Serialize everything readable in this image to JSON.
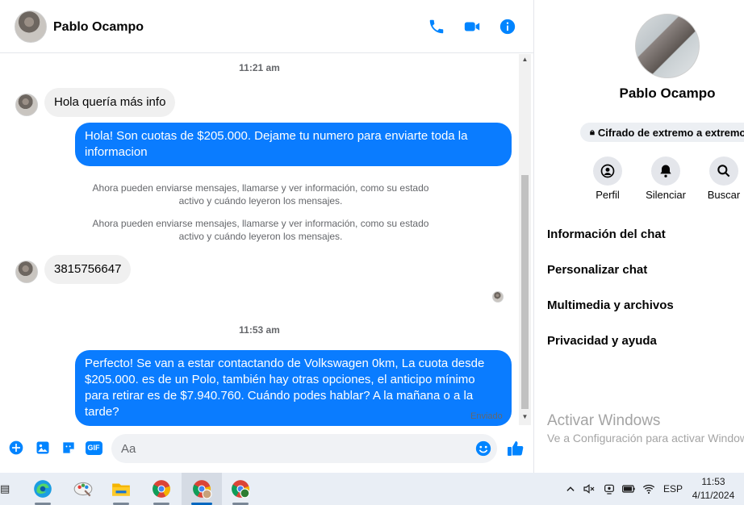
{
  "chat": {
    "contact_name": "Pablo Ocampo",
    "timestamp_1": "11:21 am",
    "msg_in_1": "Hola quería más info",
    "msg_out_1": "Hola! Son cuotas de $205.000. Dejame tu numero para enviarte toda la informacion",
    "system_note_1": "Ahora pueden enviarse mensajes, llamarse y ver información, como su estado activo y cuándo leyeron los mensajes.",
    "system_note_2": "Ahora pueden enviarse mensajes, llamarse y ver información, como su estado activo y cuándo leyeron los mensajes.",
    "msg_in_2": "3815756647",
    "timestamp_2": "11:53 am",
    "msg_out_2": "Perfecto!  Se van a estar contactando de Volkswagen 0km, La cuota desde $205.000. es de un Polo, también hay otras opciones, el anticipo mínimo para retirar es de $7.940.760. Cuándo podes hablar? A la mañana o a la tarde?",
    "status": "Enviado"
  },
  "header_icons": [
    "phone-icon",
    "video-camera-icon",
    "info-icon"
  ],
  "composer": {
    "placeholder": "Aa",
    "icons": [
      "plus-icon",
      "photo-icon",
      "sticker-icon",
      "gif-icon",
      "emoji-icon",
      "thumbs-up-icon"
    ],
    "gif_label": "GIF"
  },
  "info": {
    "name": "Pablo Ocampo",
    "encryption_badge": "Cifrado de extremo a extremo",
    "actions": [
      {
        "label": "Perfil",
        "icon": "profile-icon"
      },
      {
        "label": "Silenciar",
        "icon": "bell-icon"
      },
      {
        "label": "Buscar",
        "icon": "search-icon"
      }
    ],
    "menu": [
      "Información del chat",
      "Personalizar chat",
      "Multimedia y archivos",
      "Privacidad y ayuda"
    ],
    "watermark_title": "Activar Windows",
    "watermark_sub": "Ve a Configuración para activar Windows."
  },
  "taskbar": {
    "apps": [
      "edge-icon",
      "paint-icon",
      "file-explorer-icon",
      "chrome-icon",
      "chrome-profile-icon",
      "chrome-icon-2"
    ],
    "language": "ESP",
    "time": "11:53",
    "date": "4/11/2024"
  },
  "colors": {
    "accent": "#0084ff",
    "bubble_out": "#0a7cff",
    "bubble_in": "#f0f0f0",
    "taskbar": "#e9eef5"
  }
}
